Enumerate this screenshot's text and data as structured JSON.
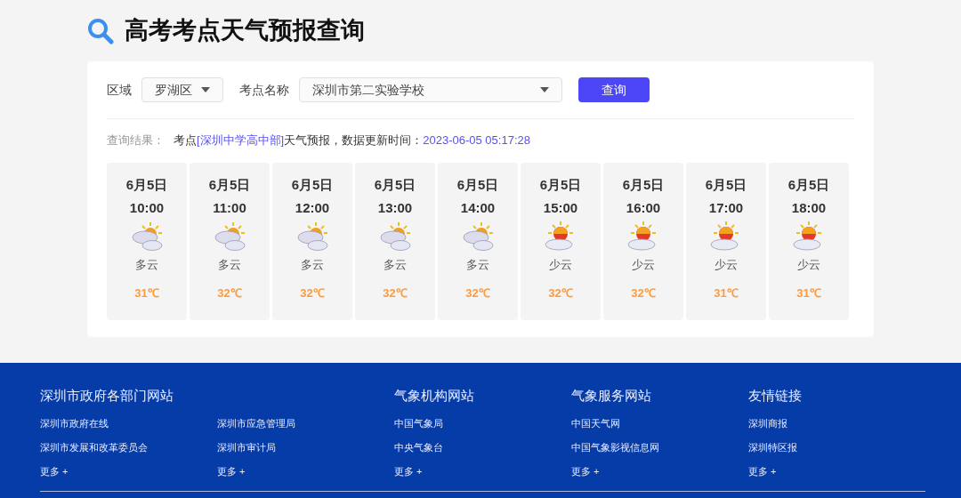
{
  "page_title": "高考考点天气预报查询",
  "filters": {
    "region_label": "区域",
    "region_value": "罗湖区",
    "site_label": "考点名称",
    "site_value": "深圳市第二实验学校",
    "query_button": "查询"
  },
  "result": {
    "label": "查询结果：",
    "prefix": "考点",
    "school": "[深圳中学高中部]",
    "suffix": "天气预报，数据更新时间：",
    "time": "2023-06-05 05:17:28"
  },
  "forecast": [
    {
      "date": "6月5日",
      "time": "10:00",
      "kind": "cloudy",
      "condition": "多云",
      "temperature": "31℃"
    },
    {
      "date": "6月5日",
      "time": "11:00",
      "kind": "cloudy",
      "condition": "多云",
      "temperature": "32℃"
    },
    {
      "date": "6月5日",
      "time": "12:00",
      "kind": "cloudy",
      "condition": "多云",
      "temperature": "32℃"
    },
    {
      "date": "6月5日",
      "time": "13:00",
      "kind": "cloudy",
      "condition": "多云",
      "temperature": "32℃"
    },
    {
      "date": "6月5日",
      "time": "14:00",
      "kind": "cloudy",
      "condition": "多云",
      "temperature": "32℃"
    },
    {
      "date": "6月5日",
      "time": "15:00",
      "kind": "few-clouds",
      "condition": "少云",
      "temperature": "32℃"
    },
    {
      "date": "6月5日",
      "time": "16:00",
      "kind": "few-clouds",
      "condition": "少云",
      "temperature": "32℃"
    },
    {
      "date": "6月5日",
      "time": "17:00",
      "kind": "few-clouds",
      "condition": "少云",
      "temperature": "31℃"
    },
    {
      "date": "6月5日",
      "time": "18:00",
      "kind": "few-clouds",
      "condition": "少云",
      "temperature": "31℃"
    }
  ],
  "footer": {
    "sections": [
      {
        "title": "深圳市政府各部门网站",
        "columns": [
          [
            "深圳市政府在线",
            "深圳市发展和改革委员会",
            "更多 +"
          ],
          [
            "深圳市应急管理局",
            "深圳市审计局",
            "更多 +"
          ]
        ]
      },
      {
        "title": "气象机构网站",
        "columns": [
          [
            "中国气象局",
            "中央气象台",
            "更多 +"
          ]
        ]
      },
      {
        "title": "气象服务网站",
        "columns": [
          [
            "中国天气网",
            "中国气象影视信息网",
            "更多 +"
          ]
        ]
      },
      {
        "title": "友情链接",
        "columns": [
          [
            "深圳商报",
            "深圳特区报",
            "更多 +"
          ]
        ]
      }
    ]
  }
}
